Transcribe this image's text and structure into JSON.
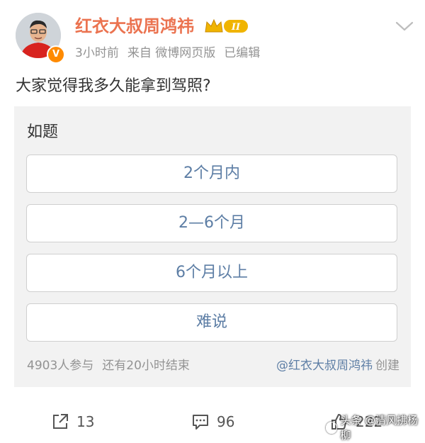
{
  "header": {
    "username": "红衣大叔周鸿祎",
    "vip_level": "II",
    "verified_mark": "V",
    "timestamp": "3小时前",
    "source": "来自 微博网页版",
    "edited": "已编辑"
  },
  "post": {
    "text": "大家觉得我多久能拿到驾照?"
  },
  "poll": {
    "title": "如题",
    "options": [
      {
        "label": "2个月内"
      },
      {
        "label": "2—6个月"
      },
      {
        "label": "6个月以上"
      },
      {
        "label": "难说"
      }
    ],
    "participants": "4903人参与",
    "time_left": "还有20小时结束",
    "creator_mention": "@红衣大叔周鸿祎",
    "created_label": "创建"
  },
  "actions": {
    "repost_count": "13",
    "comment_count": "96",
    "like_count": "222"
  },
  "watermark": {
    "text": "头条 @清风拂杨柳"
  },
  "colors": {
    "username": "#eb7350",
    "link": "#5d7ea5",
    "meta": "#939393",
    "poll_bg": "#f2f2f2",
    "vip_gold": "#f0b400"
  },
  "icons": [
    "avatar-portrait",
    "verified-icon",
    "vip-crown-icon",
    "chevron-down-icon",
    "repost-icon",
    "comment-icon",
    "like-icon"
  ]
}
